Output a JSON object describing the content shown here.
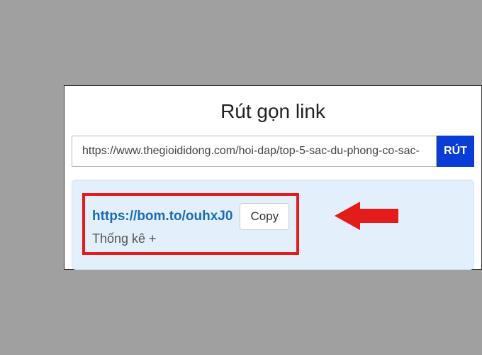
{
  "title": "Rút gọn link",
  "input": {
    "value": "https://www.thegioididong.com/hoi-dap/top-5-sac-du-phong-co-sac-"
  },
  "shorten_label": "RÚT",
  "result": {
    "short_url": "https://bom.to/ouhxJ0",
    "copy_label": "Copy",
    "stats_label": "Thống kê +"
  }
}
